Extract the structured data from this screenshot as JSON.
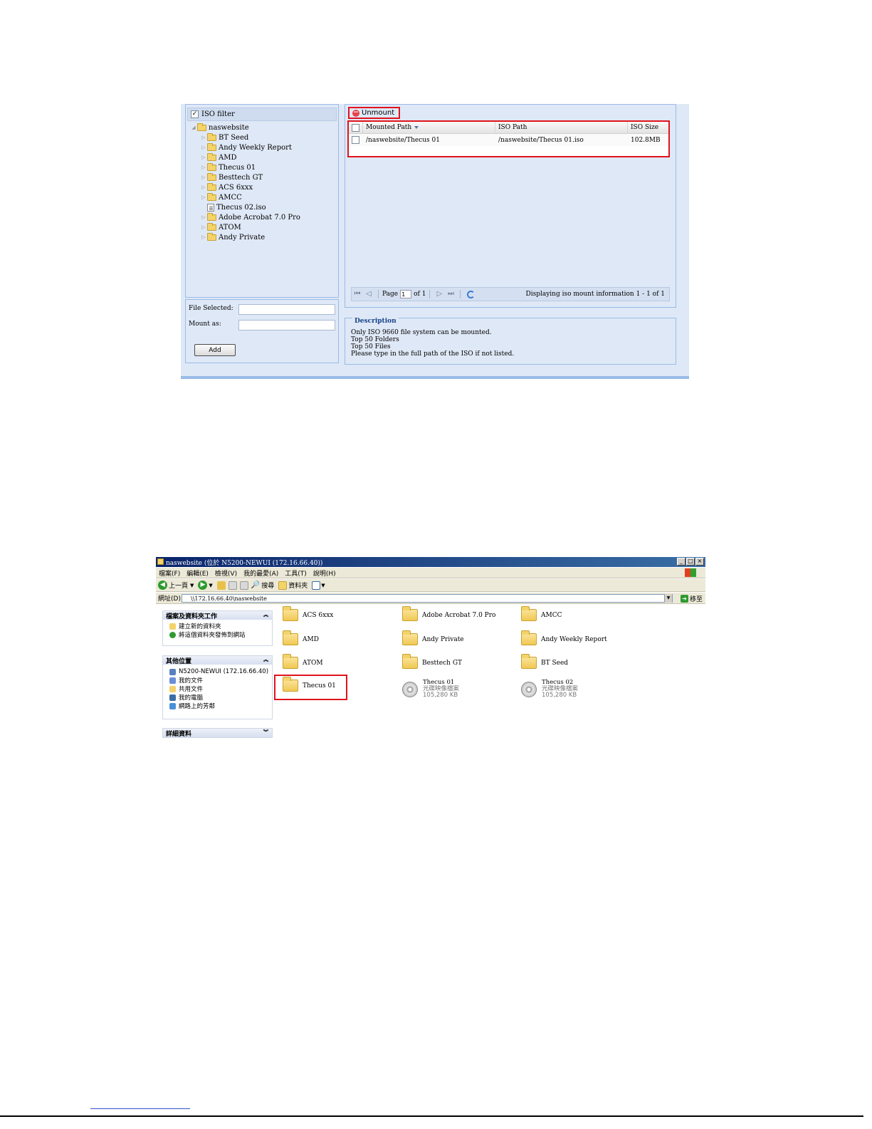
{
  "iso_mount": {
    "tree": {
      "filter_label": "ISO filter",
      "filter_checked": true,
      "root": "naswebsite",
      "children": [
        {
          "label": "BT Seed",
          "type": "folder"
        },
        {
          "label": "Andy Weekly Report",
          "type": "folder"
        },
        {
          "label": "AMD",
          "type": "folder"
        },
        {
          "label": "Thecus 01",
          "type": "folder"
        },
        {
          "label": "Besttech GT",
          "type": "folder"
        },
        {
          "label": "ACS 6xxx",
          "type": "folder"
        },
        {
          "label": "AMCC",
          "type": "folder"
        },
        {
          "label": "Thecus 02.iso",
          "type": "file"
        },
        {
          "label": "Adobe Acrobat 7.0 Pro",
          "type": "folder"
        },
        {
          "label": "ATOM",
          "type": "folder"
        },
        {
          "label": "Andy Private",
          "type": "folder"
        }
      ]
    },
    "form": {
      "file_selected_label": "File Selected:",
      "file_selected_value": "",
      "mount_as_label": "Mount as:",
      "mount_as_value": "",
      "add_button": "Add"
    },
    "toolbar": {
      "unmount_label": "Unmount"
    },
    "grid": {
      "columns": [
        "Mounted Path",
        "ISO Path",
        "ISO Size"
      ],
      "rows": [
        {
          "mounted_path": "/naswebsite/Thecus 01",
          "iso_path": "/naswebsite/Thecus 01.iso",
          "iso_size": "102.8MB"
        }
      ]
    },
    "pager": {
      "page_label": "Page",
      "page_value": "1",
      "of_label": "of 1",
      "display_info": "Displaying iso mount information 1 - 1 of 1"
    },
    "description": {
      "title": "Description",
      "lines": [
        "Only ISO 9660 file system can be mounted.",
        "Top 50 Folders",
        "Top 50 Files",
        "Please type in the full path of the ISO if not listed."
      ]
    }
  },
  "explorer": {
    "title": "naswebsite (位於 N5200-NEWUI (172.16.66.40))",
    "window_buttons": [
      "_",
      "□",
      "×"
    ],
    "menu": [
      "檔案(F)",
      "編輯(E)",
      "檢視(V)",
      "我的最愛(A)",
      "工具(T)",
      "說明(H)"
    ],
    "toolbar": {
      "back": "上一頁",
      "search": "搜尋",
      "folders": "資料夾"
    },
    "address": {
      "label": "網址(D)",
      "value": "\\\\172.16.66.40\\naswebsite",
      "go": "移至"
    },
    "tasks": {
      "title": "檔案及資料夾工作",
      "items": [
        "建立新的資料夾",
        "將這個資料夾發佈到網站"
      ]
    },
    "other_places": {
      "title": "其他位置",
      "items": [
        "N5200-NEWUI (172.16.66.40)",
        "我的文件",
        "共用文件",
        "我的電腦",
        "網路上的芳鄰"
      ]
    },
    "details": {
      "title": "詳細資料"
    },
    "files": [
      {
        "name": "ACS 6xxx",
        "type": "folder"
      },
      {
        "name": "Adobe Acrobat 7.0 Pro",
        "type": "folder"
      },
      {
        "name": "AMCC",
        "type": "folder"
      },
      {
        "name": "AMD",
        "type": "folder"
      },
      {
        "name": "Andy Private",
        "type": "folder"
      },
      {
        "name": "Andy Weekly Report",
        "type": "folder"
      },
      {
        "name": "ATOM",
        "type": "folder"
      },
      {
        "name": "Besttech GT",
        "type": "folder"
      },
      {
        "name": "BT Seed",
        "type": "folder"
      },
      {
        "name": "Thecus 01",
        "type": "folder"
      },
      {
        "name": "Thecus 01",
        "type": "iso",
        "kind": "光碟映像檔案",
        "size": "105,280 KB"
      },
      {
        "name": "Thecus 02",
        "type": "iso",
        "kind": "光碟映像檔案",
        "size": "105,280 KB"
      }
    ]
  }
}
